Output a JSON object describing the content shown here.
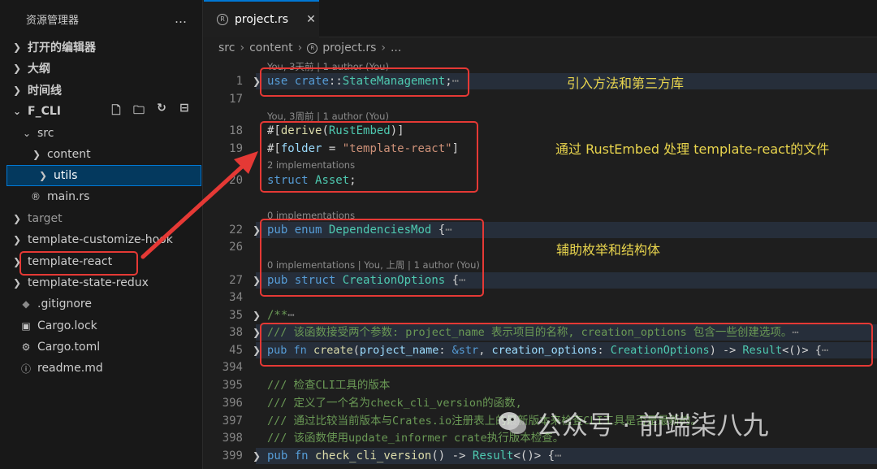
{
  "sidebar": {
    "title": "资源管理器",
    "more_icon": "…",
    "sections": [
      {
        "label": "打开的编辑器"
      },
      {
        "label": "大纲"
      },
      {
        "label": "时间线"
      }
    ],
    "project": {
      "label": "F_CLI",
      "tools": [
        "new-file-icon",
        "new-folder-icon",
        "refresh-icon",
        "collapse-all-icon"
      ]
    },
    "tree": [
      {
        "label": "src",
        "kind": "folder-open"
      },
      {
        "label": "content",
        "kind": "folder"
      },
      {
        "label": "utils",
        "kind": "folder",
        "selected": true
      },
      {
        "label": "main.rs",
        "kind": "rust-file"
      },
      {
        "label": "target",
        "kind": "folder"
      },
      {
        "label": "template-customize-hook",
        "kind": "folder"
      },
      {
        "label": "template-react",
        "kind": "folder"
      },
      {
        "label": "template-state-redux",
        "kind": "folder"
      },
      {
        "label": ".gitignore",
        "kind": "git-file"
      },
      {
        "label": "Cargo.lock",
        "kind": "lock-file"
      },
      {
        "label": "Cargo.toml",
        "kind": "gear-file"
      },
      {
        "label": "readme.md",
        "kind": "info-file"
      }
    ]
  },
  "tab": {
    "label": "project.rs",
    "close": "✕"
  },
  "breadcrumb": {
    "parts": [
      "src",
      "content",
      "project.rs",
      "..."
    ]
  },
  "editor": {
    "lenses": {
      "l1": "You, 3天前 | 1 author (You)",
      "l18": "You, 3周前 | 1 author (You)",
      "l20": "2 implementations",
      "l22": "0 implementations",
      "l27": "0 implementations | You, 上周 | 1 author (You)"
    },
    "lines": {
      "n1": "1",
      "n17": "17",
      "n18": "18",
      "n19": "19",
      "n20": "20",
      "n22": "22",
      "n26": "26",
      "n27": "27",
      "n34": "34",
      "n35": "35",
      "n38": "38",
      "n45": "45",
      "n394": "394",
      "n395": "395",
      "n396": "396",
      "n397": "397",
      "n398": "398",
      "n399": "399"
    },
    "code": {
      "c1_kw": "use",
      "c1_path": "crate",
      "c1_sep": "::",
      "c1_ty": "StateManagement",
      "c1_end": ";",
      "c18_a": "#[",
      "c18_attr": "derive",
      "c18_b": "(",
      "c18_ty": "RustEmbed",
      "c18_c": ")]",
      "c19_a": "#[",
      "c19_attr": "folder",
      "c19_b": " = ",
      "c19_str": "\"template-react\"",
      "c19_c": "]",
      "c20_kw": "struct",
      "c20_ty": "Asset",
      "c20_end": ";",
      "c22_kw1": "pub",
      "c22_kw2": "enum",
      "c22_ty": "DependenciesMod",
      "c22_end": " {",
      "c27_kw1": "pub",
      "c27_kw2": "struct",
      "c27_ty": "CreationOptions",
      "c27_end": " {",
      "c35": "/**",
      "c38": "/// 该函数接受两个参数: project_name 表示项目的名称, creation_options 包含一些创建选项。",
      "c45_kw1": "pub",
      "c45_kw2": "fn",
      "c45_fn": "create",
      "c45_p1": "project_name",
      "c45_t1": "&str",
      "c45_p2": "creation_options",
      "c45_t2": "CreationOptions",
      "c45_ret": "Result",
      "c45_tail": "<()> {",
      "c395": "/// 检查CLI工具的版本",
      "c396": "/// 定义了一个名为check_cli_version的函数,",
      "c397": "/// 通过比较当前版本与Crates.io注册表上的最新版本来检查CLI工具是否是最新的。",
      "c398": "/// 该函数使用update_informer crate执行版本检查。",
      "c399_kw1": "pub",
      "c399_kw2": "fn",
      "c399_fn": "check_cli_version",
      "c399_mid": "() -> ",
      "c399_ret": "Result",
      "c399_tail": "<()> {",
      "ellipsis": "⋯"
    }
  },
  "annotations": {
    "note1": "引入方法和第三方库",
    "note2": "通过 RustEmbed 处理 template-react的文件",
    "note3": "辅助枚举和结构体",
    "color": "#e53935",
    "note_color": "#e8d44d"
  },
  "watermark": {
    "text": "公众号 · 前端柒八九",
    "icon": "wechat-icon"
  }
}
